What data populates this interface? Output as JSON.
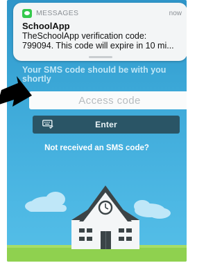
{
  "notification": {
    "app": "MESSAGES",
    "time": "now",
    "title": "SchoolApp",
    "body_line1": "TheSchoolApp verification code:",
    "body_line2": "799094. This code will expire in 10 mi...",
    "icon": "message-bubble-icon",
    "icon_color": "#33c84b"
  },
  "main": {
    "subtitle": "Your SMS code should be with you shortly",
    "code_input": {
      "value": "",
      "placeholder": "Access code"
    },
    "enter_label": "Enter",
    "enter_icon": "keyboard-check-icon",
    "resend_link": "Not received an SMS code?"
  },
  "colors": {
    "background_top": "#2f95c9",
    "background_bottom": "#55bfe8",
    "button": "#2a5566",
    "grass": "#8fd14f"
  }
}
